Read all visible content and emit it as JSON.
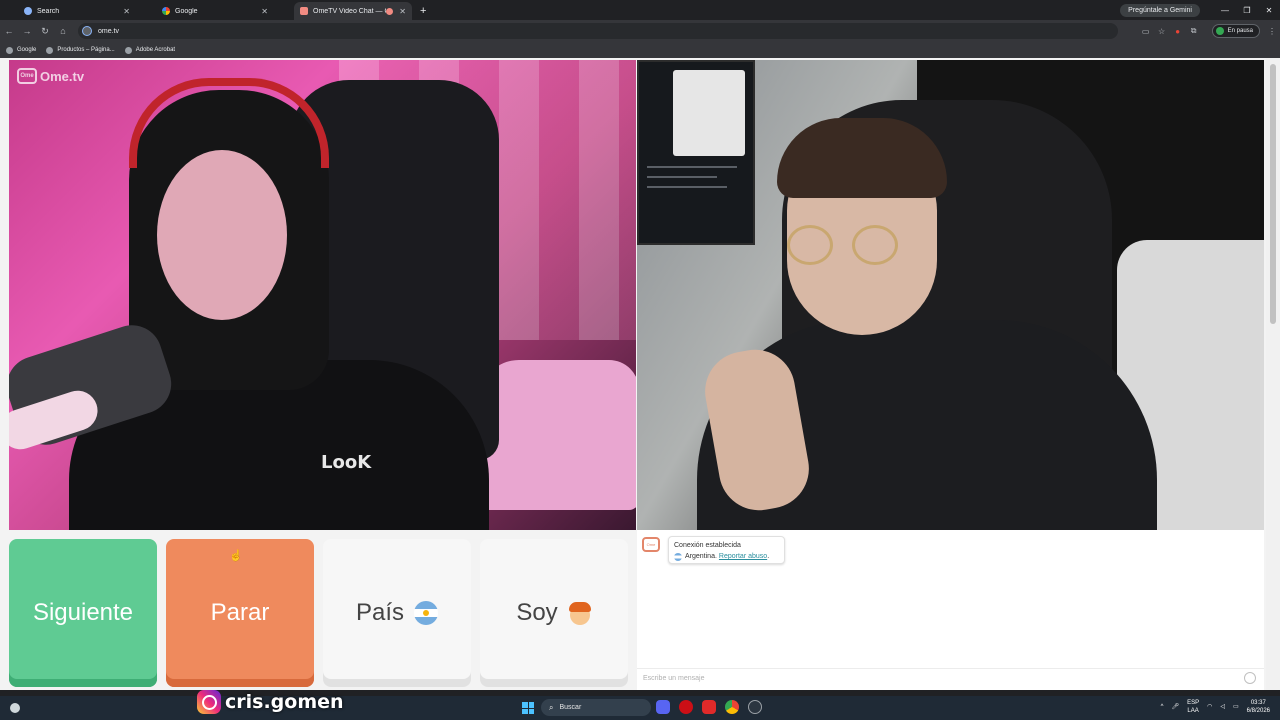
{
  "browser": {
    "tabs": [
      {
        "title": "Search",
        "active": false
      },
      {
        "title": "Google",
        "active": false
      },
      {
        "title": "OmeTV Video Chat — Ome",
        "active": true
      }
    ],
    "gemini_button": "Pregúntale a Gemini",
    "url": "ome.tv",
    "profile_status": "En pausa",
    "bookmarks": [
      "Google",
      "Productos – Página...",
      "Adobe Acrobat"
    ]
  },
  "ome": {
    "logo": "Ome.tv",
    "logo_box": "Ome",
    "buttons": {
      "next": "Siguiente",
      "stop": "Parar",
      "country": "País",
      "gender": "Soy"
    },
    "colors": {
      "next": "#5fcb93",
      "stop": "#ef8a5d"
    },
    "chat": {
      "avatar_label": "Ome",
      "status": "Conexión establecida",
      "country": "Argentina.",
      "report_link": "Reportar abuso",
      "input_placeholder": "Escribe un mensaje"
    },
    "left_shirt_text": "LooK"
  },
  "overlay": {
    "instagram_handle": "cris.gomen"
  },
  "taskbar": {
    "search_placeholder": "Buscar",
    "language": "ESP",
    "language_sub": "LAA",
    "time": "03:37",
    "date": "6/8/2026"
  }
}
